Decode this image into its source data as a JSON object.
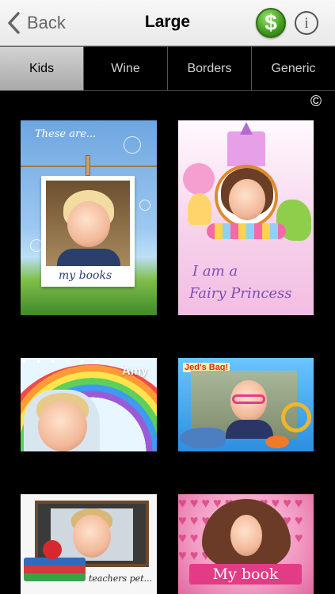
{
  "nav": {
    "back_label": "Back",
    "title": "Large",
    "dollar_symbol": "$",
    "info_symbol": "i"
  },
  "segments": [
    {
      "label": "Kids",
      "active": true
    },
    {
      "label": "Wine",
      "active": false
    },
    {
      "label": "Borders",
      "active": false
    },
    {
      "label": "Generic",
      "active": false
    }
  ],
  "copyright_symbol": "©",
  "templates": {
    "t1": {
      "top_text": "These are...",
      "bottom_text": "my books"
    },
    "t2": {
      "line1": "I am a",
      "line2": "Fairy Princess"
    },
    "t3": {
      "name": "Amy"
    },
    "t4": {
      "caption": "Jed's Bag!"
    },
    "t5": {
      "caption": "teachers pet..."
    },
    "t6": {
      "caption": "My book"
    }
  },
  "colors": {
    "nav_bg": "#f2f2f2",
    "segment_active": "#bdbdbd",
    "dollar_green": "#3f9a1e"
  }
}
